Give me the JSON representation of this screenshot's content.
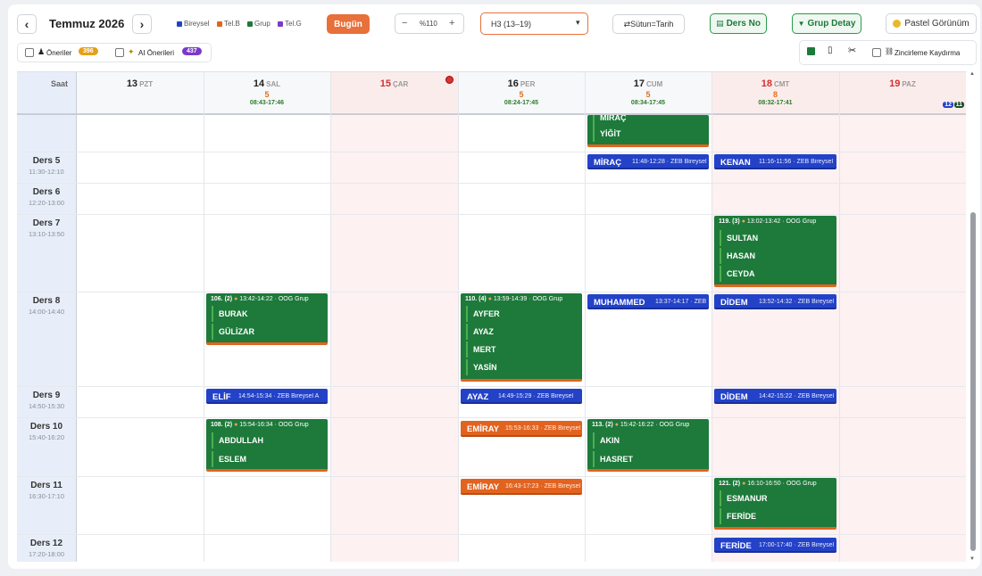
{
  "toolbar": {
    "prev_label": "‹",
    "next_label": "›",
    "month_title": "Temmuz 2026",
    "legend": [
      {
        "label": "Bireysel",
        "color": "#2342c8"
      },
      {
        "label": "Tel.B",
        "color": "#e2631f"
      },
      {
        "label": "Grup",
        "color": "#1d7a3a"
      },
      {
        "label": "Tel.G",
        "color": "#7a3ac8"
      }
    ],
    "today_label": "Bugün",
    "zoom_minus": "−",
    "zoom_value": "%110",
    "zoom_plus": "+",
    "week_select": "H3 (13–19)",
    "column_toggle": "⇄Sütun=Tarih",
    "ders_no_label": "Ders No",
    "grup_detay_label": "Grup Detay",
    "pastel_label": "Pastel Görünüm"
  },
  "filters": {
    "oneriler_label": "Öneriler",
    "oneriler_count": "396",
    "ai_label": "AI Önerileri",
    "ai_count": "437",
    "zincirleme_label": "Zincirleme Kaydırma"
  },
  "grid": {
    "saat_label": "Saat",
    "badges": [
      "12",
      "11"
    ],
    "days": [
      {
        "num": "13",
        "dw": "PZT",
        "count": "",
        "range": "",
        "weekend": false
      },
      {
        "num": "14",
        "dw": "SAL",
        "count": "5",
        "range": "08:43-17:46",
        "weekend": false
      },
      {
        "num": "15",
        "dw": "ÇAR",
        "count": "",
        "range": "",
        "weekend": true
      },
      {
        "num": "16",
        "dw": "PER",
        "count": "5",
        "range": "08:24-17:45",
        "weekend": false
      },
      {
        "num": "17",
        "dw": "CUM",
        "count": "5",
        "range": "08:34-17:45",
        "weekend": false
      },
      {
        "num": "18",
        "dw": "CMT",
        "count": "8",
        "range": "08:32-17:41",
        "weekend": true
      },
      {
        "num": "19",
        "dw": "PAZ",
        "count": "",
        "range": "",
        "weekend": true
      }
    ],
    "slots": [
      {
        "name": "Ders 5",
        "time": "11:30-12:10"
      },
      {
        "name": "Ders 6",
        "time": "12:20-13:00"
      },
      {
        "name": "Ders 7",
        "time": "13:10-13:50"
      },
      {
        "name": "Ders 8",
        "time": "14:00-14:40"
      },
      {
        "name": "Ders 9",
        "time": "14:50-15:30"
      },
      {
        "name": "Ders 10",
        "time": "15:40-16:20"
      },
      {
        "name": "Ders 11",
        "time": "16:30-17:10"
      },
      {
        "name": "Ders 12",
        "time": "17:20-18:00"
      }
    ]
  },
  "events": {
    "e1": {
      "name": "MİRAÇ",
      "detail": "11:48-12:28 · ZEB Bireysel"
    },
    "e2": {
      "name": "KENAN",
      "detail": "11:16-11:56 · ZEB Bireysel"
    },
    "e3": {
      "name": "MUHAMMED",
      "detail": "13:37-14:17 · ZEB"
    },
    "e4": {
      "name": "DİDEM",
      "detail": "13:52-14:32 · ZEB Bireysel"
    },
    "e5": {
      "name": "ELİF",
      "detail": "14:54-15:34 · ZEB Bireysel A"
    },
    "e6": {
      "name": "AYAZ",
      "detail": "14:49-15:29 · ZEB Bireysel"
    },
    "e7": {
      "name": "DİDEM",
      "detail": "14:42-15:22 · ZEB Bireysel"
    },
    "e8": {
      "name": "EMİRAY",
      "detail": "15:53-16:33 · ZEB Bireysel"
    },
    "e9": {
      "name": "EMİRAY",
      "detail": "16:43-17:23 · ZEB Bireysel"
    },
    "e10": {
      "name": "FERİDE",
      "detail": "17:00-17:40 · ZEB Bireysel"
    },
    "g0": {
      "members": [
        "MİRAÇ",
        "YİĞİT"
      ]
    },
    "g1": {
      "head_no": "119. (3)",
      "head_info": "13:02-13:42 · OOG Grup",
      "members": [
        "SULTAN",
        "HASAN",
        "CEYDA"
      ]
    },
    "g2": {
      "head_no": "106. (2)",
      "head_info": "13:42-14:22 · OOG Grup",
      "members": [
        "BURAK",
        "GÜLİZAR"
      ]
    },
    "g3": {
      "head_no": "110. (4)",
      "head_info": "13:59-14:39 · OOG Grup",
      "members": [
        "AYFER",
        "AYAZ",
        "MERT",
        "YASİN"
      ]
    },
    "g4": {
      "head_no": "108. (2)",
      "head_info": "15:54-16:34 · OOG Grup",
      "members": [
        "ABDULLAH",
        "ESLEM"
      ]
    },
    "g5": {
      "head_no": "113. (2)",
      "head_info": "15:42-16:22 · OOG Grup",
      "members": [
        "AKIN",
        "HASRET"
      ]
    },
    "g6": {
      "head_no": "121. (2)",
      "head_info": "16:10-16:50 · OOG Grup",
      "members": [
        "ESMANUR",
        "FERİDE"
      ]
    }
  }
}
